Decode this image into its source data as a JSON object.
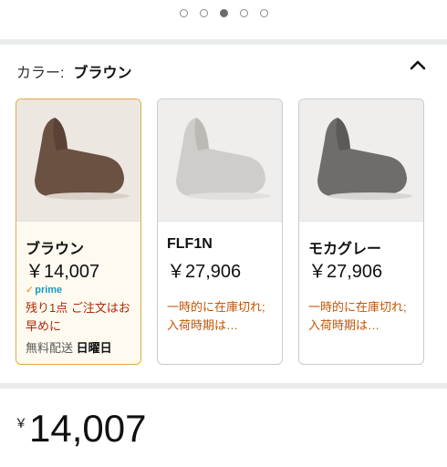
{
  "carousel": {
    "count": 5,
    "active": 2
  },
  "color": {
    "label": "カラー:",
    "value": "ブラウン",
    "collapse_icon": "chevron-up-icon"
  },
  "variants": [
    {
      "name": "ブラウン",
      "price": "￥14,007",
      "prime": "prime",
      "stock_text": "残り1点 ご注文はお早めに",
      "shipping_label": "無料配送",
      "shipping_day": "日曜日",
      "color_hex": "#6b5142"
    },
    {
      "name": "FLF1N",
      "price": "￥27,906",
      "availability": "一時的に在庫切れ; 入荷時期は…",
      "color_hex": "#cfcdc9"
    },
    {
      "name": "モカグレー",
      "price": "￥27,906",
      "availability": "一時的に在庫切れ; 入荷時期は…",
      "color_hex": "#6f6c69"
    }
  ],
  "price": {
    "symbol": "￥",
    "amount": "14,007"
  }
}
